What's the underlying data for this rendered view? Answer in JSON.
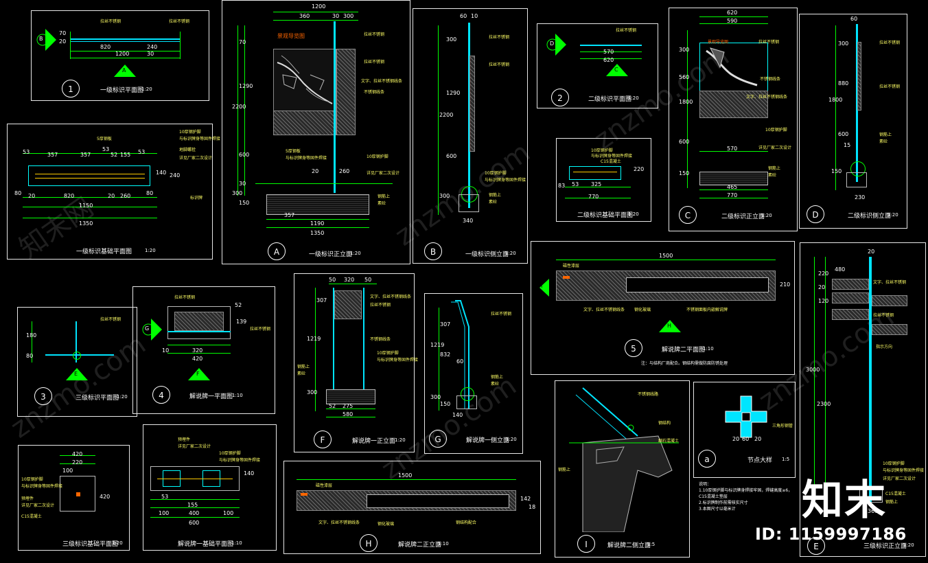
{
  "watermarks": {
    "logo": "知末",
    "id": "ID: 1159997186",
    "site": "znzmo.com",
    "cn": "知末网"
  },
  "panels": {
    "p1": {
      "tag": "1",
      "title": "一级标识平面图",
      "scale": "1:20",
      "dims": [
        "10",
        "20",
        "70",
        "820",
        "1200",
        "20",
        "240",
        "30"
      ],
      "sec_b": "B",
      "sec_a": "A"
    },
    "p1f": {
      "title": "一级标识基础平面图",
      "scale": "1:20",
      "dims": [
        "53",
        "357",
        "357",
        "53",
        "52",
        "155",
        "53",
        "80",
        "20",
        "820",
        "20",
        "260",
        "80",
        "1150",
        "1350",
        "140",
        "240"
      ],
      "notes": [
        "5厚钢板",
        "10厚钢护脚",
        "与标识牌身等固件焊接",
        "地脚螺栓",
        "详见厂家二次设计",
        "标识牌"
      ]
    },
    "pA": {
      "tag": "A",
      "title": "一级标识正立面",
      "scale": "1:20",
      "dims": [
        "1200",
        "360",
        "30",
        "300",
        "70",
        "1290",
        "2200",
        "600",
        "30",
        "300",
        "150",
        "20",
        "260",
        "20",
        "80",
        "357",
        "1190",
        "1350"
      ],
      "notes": [
        "景观导览图",
        "拉丝不锈钢",
        "文字、拉丝不锈钢线条",
        "不锈钢线条",
        "5厚钢板",
        "与标识牌身等固件焊接",
        "10厚钢护脚",
        "详见厂家二次设计",
        "钢筋上",
        "素砼"
      ]
    },
    "pB": {
      "tag": "B",
      "title": "一级标识侧立面",
      "scale": "1:20",
      "dims": [
        "60",
        "10",
        "300",
        "1290",
        "2200",
        "600",
        "30",
        "300",
        "340"
      ],
      "notes": [
        "拉丝不锈钢",
        "拉丝不锈钢",
        "10厚钢护脚",
        "与标识牌身等固件焊接",
        "钢筋上",
        "素砼"
      ]
    },
    "p2": {
      "tag": "2",
      "title": "二级标识平面图",
      "scale": "1:20",
      "dims": [
        "570",
        "620",
        "10",
        "20"
      ],
      "sec_d": "D",
      "sec_c": "C"
    },
    "p2f": {
      "title": "二级标识基础平面图",
      "scale": "1:20",
      "dims": [
        "53",
        "70",
        "325",
        "70",
        "53",
        "20",
        "770",
        "83",
        "220",
        "95"
      ],
      "notes": [
        "10厚钢护脚",
        "与标识牌身等固件焊接",
        "C15混凝土",
        "详见厂家二次设计"
      ]
    },
    "pC": {
      "tag": "C",
      "title": "二级标识正立面",
      "scale": "1:20",
      "dims": [
        "620",
        "590",
        "10",
        "300",
        "560",
        "1800",
        "600",
        "570",
        "150",
        "20",
        "465",
        "770"
      ],
      "notes": [
        "拉丝不锈钢",
        "不锈钢线条",
        "文字、拉丝不锈钢线条",
        "10厚钢护脚",
        "详见厂家二次设计",
        "钢筋上",
        "素砼"
      ]
    },
    "pD": {
      "tag": "D",
      "title": "二级标识侧立面",
      "scale": "1:20",
      "dims": [
        "60",
        "10",
        "300",
        "880",
        "1800",
        "600",
        "15",
        "150",
        "45",
        "230"
      ],
      "notes": [
        "拉丝不锈钢",
        "钢筋上",
        "素砼"
      ]
    },
    "p3": {
      "tag": "3",
      "title": "三级标识平面图",
      "scale": "1:20",
      "dims": [
        "180",
        "80"
      ],
      "sec_e": "E"
    },
    "p4": {
      "tag": "4",
      "title": "解说牌一平面图",
      "scale": "1:10",
      "dims": [
        "10",
        "320",
        "420",
        "52",
        "139",
        "52"
      ],
      "sec_g": "G",
      "sec_f": "F"
    },
    "pF": {
      "tag": "F",
      "title": "解说牌一正立面",
      "scale": "1:20",
      "dims": [
        "50",
        "320",
        "50",
        "307",
        "1219",
        "300",
        "100",
        "52",
        "275",
        "580"
      ],
      "notes": [
        "文字、拉丝不锈钢线条",
        "拉丝不锈钢",
        "不锈钢线条",
        "10厚钢护脚",
        "与标识牌身等固件焊接",
        "钢筋上",
        "素砼"
      ]
    },
    "pG": {
      "tag": "G",
      "title": "解说牌一侧立面",
      "scale": "1:20",
      "dims": [
        "307",
        "1219",
        "832",
        "60",
        "300",
        "150",
        "45",
        "140",
        "45"
      ],
      "notes": [
        "拉丝不锈钢",
        "钢筋上",
        "素砼"
      ]
    },
    "p5": {
      "tag": "5",
      "title": "解说牌二平面图",
      "scale": "1:10",
      "dims": [
        "1500",
        "210"
      ],
      "sec_h": "H",
      "sec_i": "I",
      "notes": [
        "磁性漆层",
        "文字、拉丝不锈钢线条",
        "钢化玻璃",
        "不锈钢面板内嵌解说牌",
        "注：与结构厂商配合。钢结构需做防腐防锈处理"
      ]
    },
    "pI": {
      "tag": "I",
      "title": "解说牌二侧立面",
      "scale": "1:5",
      "notes": [
        "不锈钢线路",
        "钢结构",
        "细石混凝土",
        "钢筋上"
      ]
    },
    "pa": {
      "tag": "a",
      "title": "节点大样",
      "scale": "1:5",
      "dims": [
        "20",
        "60",
        "20"
      ],
      "notes": [
        "三角形钢管"
      ]
    },
    "p3f": {
      "title": "三级标识基础平面图",
      "scale": "1:20",
      "dims": [
        "420",
        "220",
        "100",
        "80",
        "100",
        "100",
        "420"
      ],
      "notes": [
        "10厚钢护脚",
        "与标识牌身等固件焊接",
        "详见厂家二次设计",
        "C15混凝土",
        "预埋件"
      ]
    },
    "pJ": {
      "title": "解说牌一基础平面图",
      "scale": "1:10",
      "dims": [
        "53",
        "70",
        "155",
        "70",
        "53",
        "17",
        "100",
        "400",
        "100",
        "600",
        "140",
        "50",
        "50",
        "140"
      ],
      "notes": [
        "预埋件",
        "详见厂家二次设计",
        "10厚钢护脚",
        "与标识牌身等固件焊接"
      ]
    },
    "pH": {
      "tag": "H",
      "title": "解说牌二正立面",
      "scale": "1:10",
      "dims": [
        "1500",
        "142",
        "18"
      ],
      "notes": [
        "磁性漆层",
        "文字、拉丝不锈钢线条",
        "钢化玻璃",
        "钢结构配合"
      ]
    },
    "pE": {
      "tag": "E",
      "title": "三级标识正立面",
      "scale": "1:20",
      "dims": [
        "480",
        "20",
        "220",
        "20",
        "120",
        "3000",
        "2300",
        "360"
      ],
      "notes": [
        "文字、拉丝不锈钢",
        "拉丝不锈钢",
        "指示方向",
        "10厚钢护脚",
        "与标识牌身等固件焊接",
        "详见厂家二次设计",
        "C15混凝土",
        "钢筋上",
        "说明：",
        "1.10厚钢护脚与标识牌身焊接牢固，焊缝高度≥6，C15混凝土垫层",
        "2.标识牌制作前需核实尺寸",
        "3.本图尺寸以毫米计"
      ]
    }
  }
}
